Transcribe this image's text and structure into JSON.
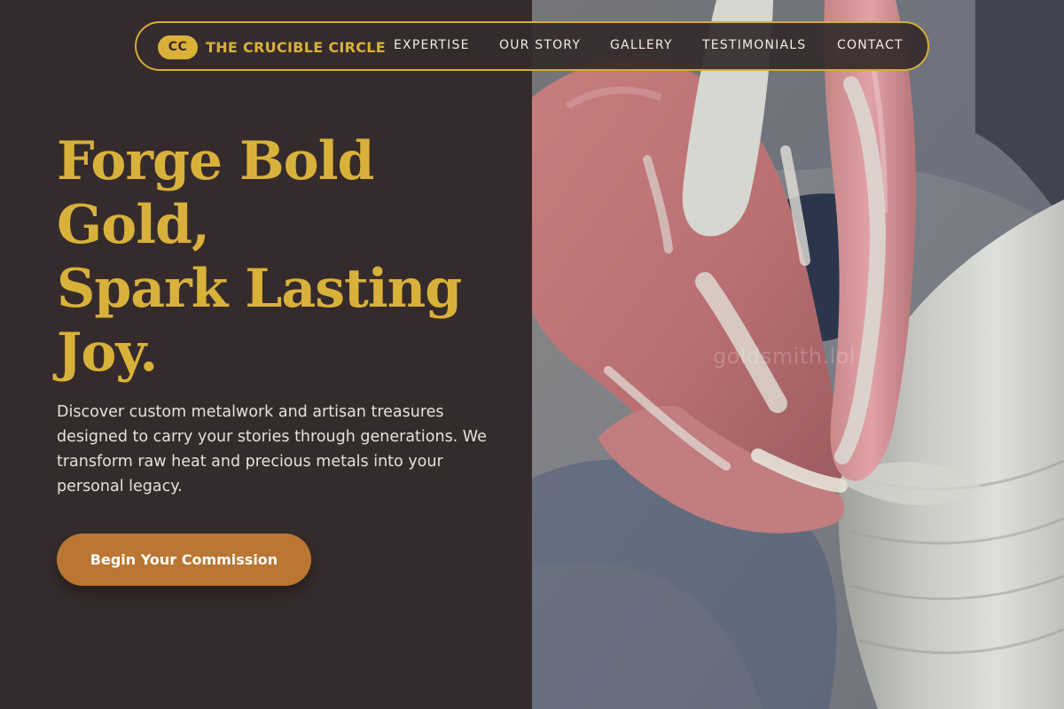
{
  "brand": {
    "badge": "CC",
    "name": "THE CRUCIBLE CIRCLE"
  },
  "nav": {
    "items": [
      {
        "label": "EXPERTISE"
      },
      {
        "label": "OUR STORY"
      },
      {
        "label": "GALLERY"
      },
      {
        "label": "TESTIMONIALS"
      },
      {
        "label": "CONTACT"
      }
    ]
  },
  "hero": {
    "headline_lines": [
      "Forge Bold",
      "Gold,",
      "Spark Lasting",
      "Joy."
    ],
    "description": "Discover custom metalwork and artisan treasures designed to carry your stories through generations. We transform raw heat and precious metals into your personal legacy.",
    "cta_label": "Begin Your Commission",
    "image_watermark": "goldsmith.lol"
  },
  "colors": {
    "background": "#362b2c",
    "accent_gold": "#d8b13b",
    "cta_copper": "#ba7632",
    "text_light": "#e7dfd9"
  },
  "icons": {
    "brand_badge": "monogram-badge",
    "hero_image": "hands-shaping-clay-photo"
  }
}
